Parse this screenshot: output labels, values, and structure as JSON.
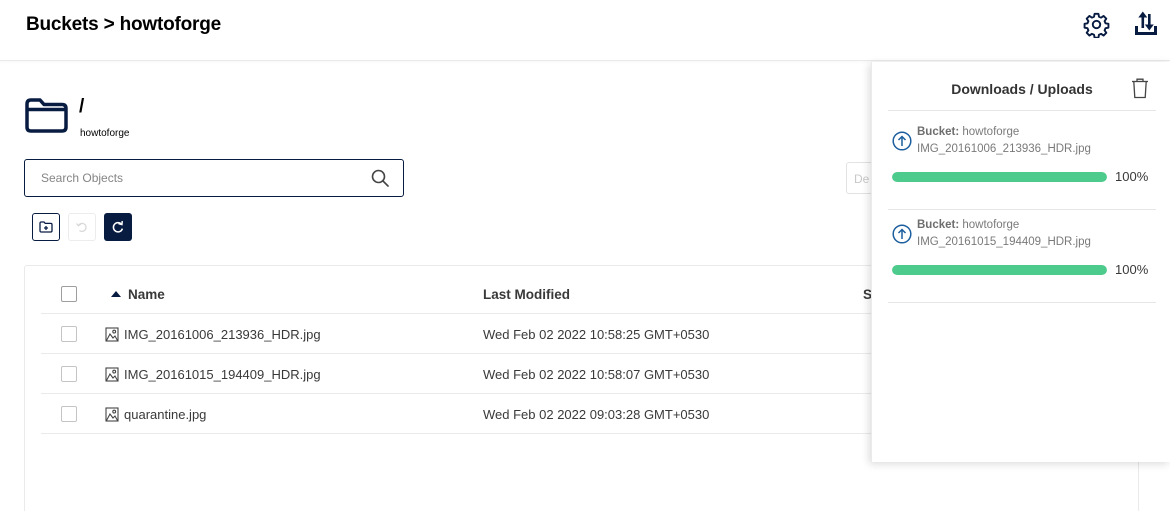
{
  "header": {
    "breadcrumb": "Buckets > howtoforge",
    "settings_icon": "gear-icon",
    "transfers_icon": "upload-download-icon"
  },
  "folder": {
    "path": "/",
    "bucket": "howtoforge",
    "icon": "folder-icon"
  },
  "search": {
    "placeholder": "Search Objects"
  },
  "date_field": {
    "partial_text": "De"
  },
  "toolbar": {
    "buttons": [
      "new-path-icon",
      "rewind-icon",
      "refresh-icon"
    ]
  },
  "table": {
    "columns": [
      "Name",
      "Last Modified",
      "S"
    ],
    "sort_column": "Name",
    "sort_direction": "ascending",
    "rows": [
      {
        "name": "IMG_20161006_213936_HDR.jpg",
        "modified": "Wed Feb 02 2022 10:58:25 GMT+0530"
      },
      {
        "name": "IMG_20161015_194409_HDR.jpg",
        "modified": "Wed Feb 02 2022 10:58:07 GMT+0530"
      },
      {
        "name": "quarantine.jpg",
        "modified": "Wed Feb 02 2022 09:03:28 GMT+0530"
      }
    ]
  },
  "panel": {
    "title": "Downloads / Uploads",
    "items": [
      {
        "bucket_label": "Bucket:",
        "bucket": "howtoforge",
        "file": "IMG_20161006_213936_HDR.jpg",
        "progress": 100,
        "progress_label": "100%"
      },
      {
        "bucket_label": "Bucket:",
        "bucket": "howtoforge",
        "file": "IMG_20161015_194409_HDR.jpg",
        "progress": 100,
        "progress_label": "100%"
      }
    ]
  },
  "colors": {
    "primary": "#081c42",
    "progress": "#4ccb8d",
    "upload_icon": "#1c5e9e"
  }
}
